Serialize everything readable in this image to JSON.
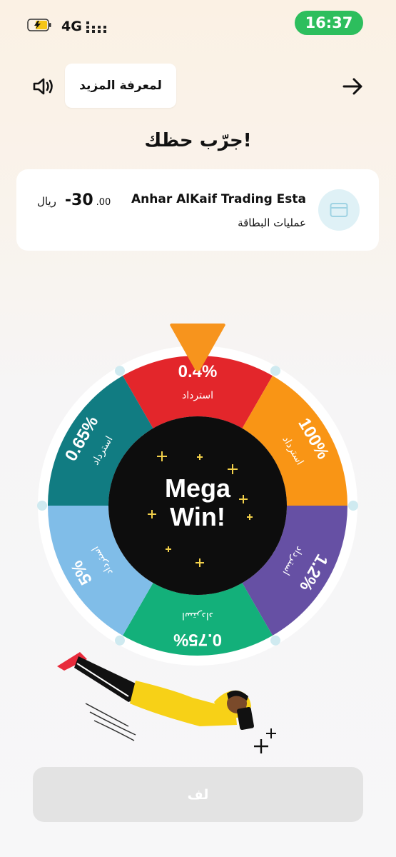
{
  "status_bar": {
    "network": "4G",
    "time": "16:37"
  },
  "header": {
    "learn_more_label": "لمعرفة المزيد",
    "title": "جرّب حظك!"
  },
  "transaction": {
    "merchant": "Anhar AlKaif Trading Esta",
    "category": "عمليات البطاقة",
    "amount_main": "-30",
    "amount_decimal": ".00",
    "currency": "ريال"
  },
  "wheel": {
    "center_line1": "Mega",
    "center_line2": "Win!",
    "segments": [
      {
        "value": "0.4%",
        "label": "استرداد",
        "color": "#e3262b"
      },
      {
        "value": "100%",
        "label": "استرداد",
        "color": "#f99515"
      },
      {
        "value": "1.2%",
        "label": "استرداد",
        "color": "#6650a4"
      },
      {
        "value": "0.75%",
        "label": "استرداد",
        "color": "#13b07a"
      },
      {
        "value": "5%",
        "label": "استرداد",
        "color": "#80bde8"
      },
      {
        "value": "0.65%",
        "label": "استرداد",
        "color": "#117c82"
      }
    ],
    "pointer_color": "#f7941d",
    "center_color": "#0d0d0d",
    "dot_color": "#cfeaf0"
  },
  "spin_button": {
    "label": "لف"
  }
}
